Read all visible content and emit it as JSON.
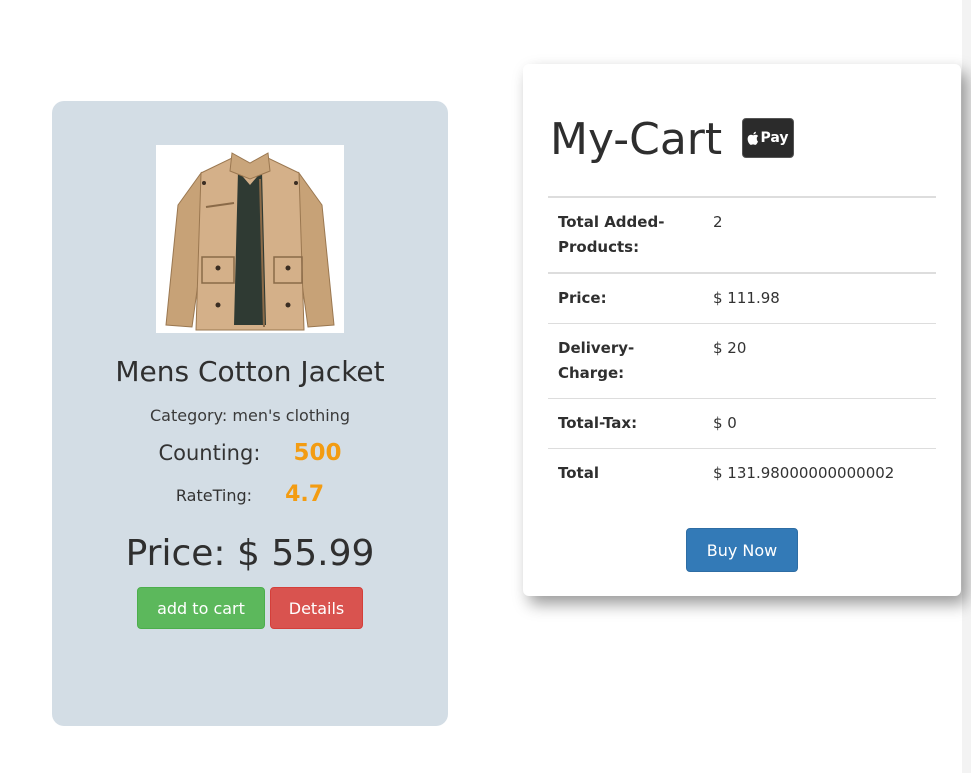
{
  "product": {
    "title": "Mens Cotton Jacket",
    "category": "Category: men's clothing",
    "counting_label": "Counting:",
    "counting_value": "500",
    "rating_label": "RateTing:",
    "rating_value": "4.7",
    "price": "Price: $ 55.99",
    "add_to_cart_label": "add to cart",
    "details_label": "Details"
  },
  "cart": {
    "title": "My-Cart",
    "pay_badge": "Pay",
    "rows": [
      {
        "label": "Total Added-Products:",
        "value": "2"
      },
      {
        "label": "Price:",
        "value": "$ 111.98"
      },
      {
        "label": "Delivery-Charge:",
        "value": "$ 20"
      },
      {
        "label": "Total-Tax:",
        "value": "$ 0"
      },
      {
        "label": "Total",
        "value": "$ 131.98000000000002"
      }
    ],
    "buy_label": "Buy Now"
  },
  "colors": {
    "card_bg": "#d3dde5",
    "accent_orange": "#f39c12",
    "success": "#5cb85c",
    "danger": "#d9534f",
    "primary": "#337ab7"
  }
}
